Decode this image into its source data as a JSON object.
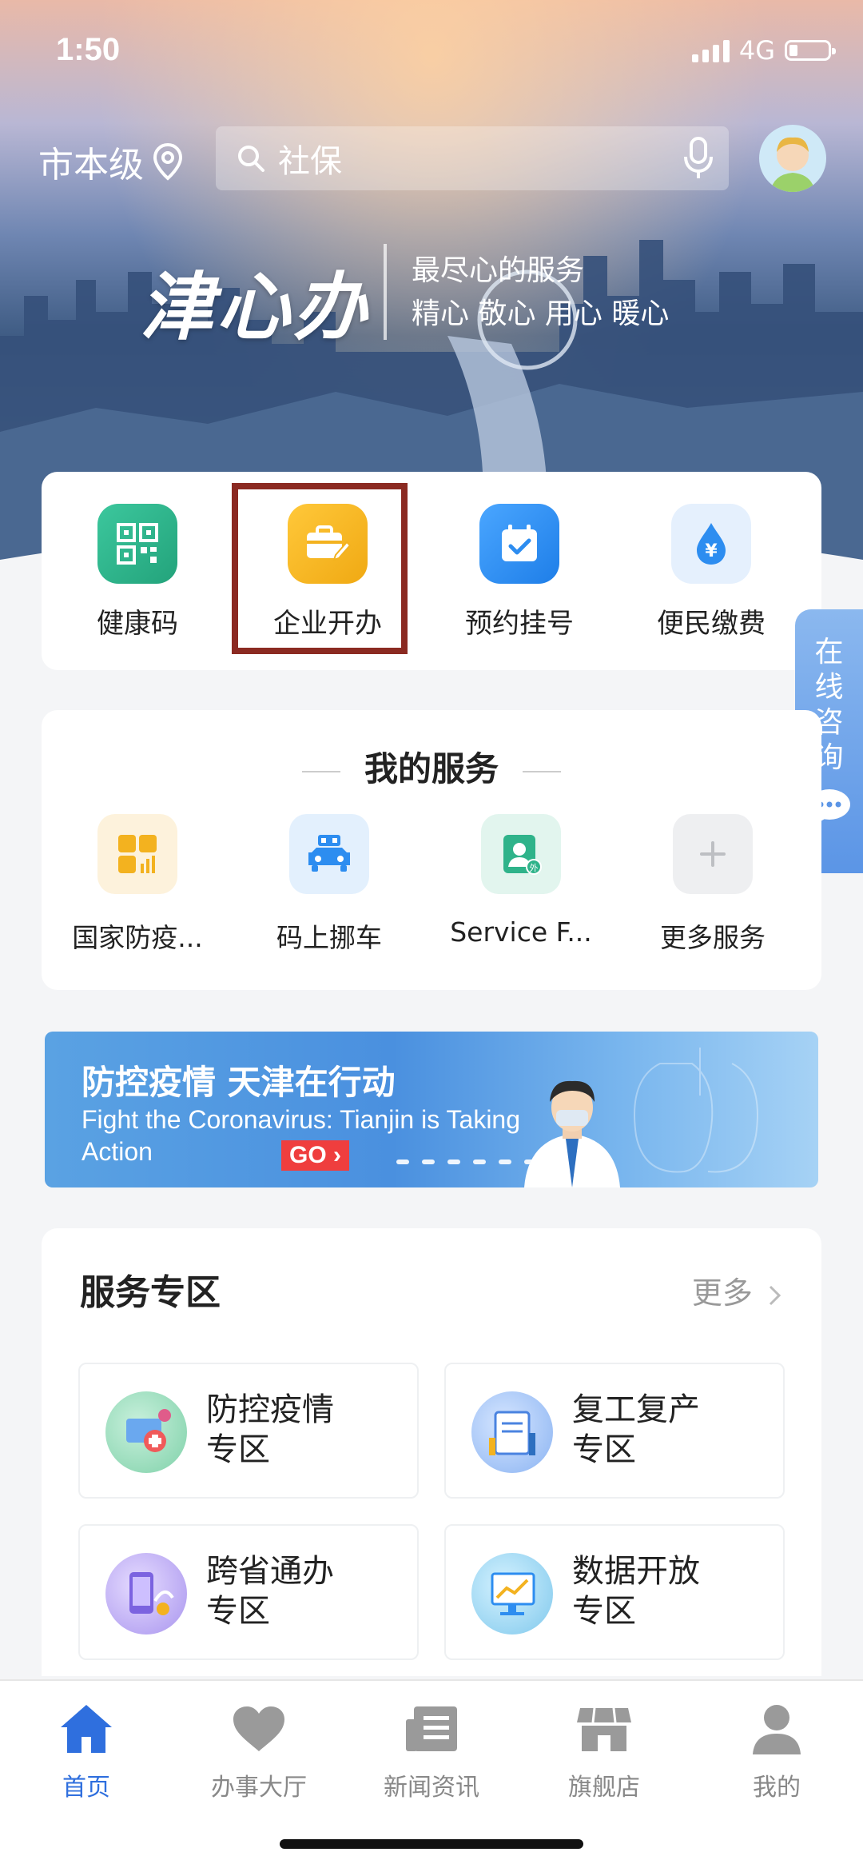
{
  "status_bar": {
    "time": "1:50",
    "network": "4G"
  },
  "header": {
    "location": "市本级",
    "search_placeholder": "社保",
    "brand": "津心办",
    "slogan_line1": "最尽心的服务",
    "slogan_line2": "精心  敬心  用心  暖心"
  },
  "quick_actions": [
    {
      "label": "健康码",
      "icon": "qr-code-icon",
      "color": "#2fb38a"
    },
    {
      "label": "企业开办",
      "icon": "briefcase-icon",
      "color": "#f3b21f"
    },
    {
      "label": "预约挂号",
      "icon": "calendar-check-icon",
      "color": "#2d8df0"
    },
    {
      "label": "便民缴费",
      "icon": "yuan-drop-icon",
      "color": "#3a8ff0"
    }
  ],
  "side_tab": {
    "label": "在线咨询"
  },
  "my_services": {
    "title": "我的服务",
    "items": [
      {
        "label": "国家防疫...",
        "icon": "grid-chart-icon"
      },
      {
        "label": "码上挪车",
        "icon": "car-icon"
      },
      {
        "label": "Service F...",
        "icon": "foreigner-id-icon"
      },
      {
        "label": "更多服务",
        "icon": "plus-icon"
      }
    ]
  },
  "banner": {
    "title": "防控疫情 天津在行动",
    "subtitle": "Fight the Coronavirus: Tianjin is Taking Action",
    "cta": "GO ›"
  },
  "service_zone": {
    "title": "服务专区",
    "more": "更多",
    "items": [
      {
        "line1": "防控疫情",
        "line2": "专区"
      },
      {
        "line1": "复工复产",
        "line2": "专区"
      },
      {
        "line1": "跨省通办",
        "line2": "专区"
      },
      {
        "line1": "数据开放",
        "line2": "专区"
      }
    ]
  },
  "tabs": [
    {
      "label": "首页",
      "icon": "home-icon",
      "active": true
    },
    {
      "label": "办事大厅",
      "icon": "heart-icon",
      "active": false
    },
    {
      "label": "新闻资讯",
      "icon": "news-icon",
      "active": false
    },
    {
      "label": "旗舰店",
      "icon": "store-icon",
      "active": false
    },
    {
      "label": "我的",
      "icon": "user-icon",
      "active": false
    }
  ],
  "colors": {
    "accent": "#2f6fde",
    "highlight_border": "#8b2a22"
  }
}
